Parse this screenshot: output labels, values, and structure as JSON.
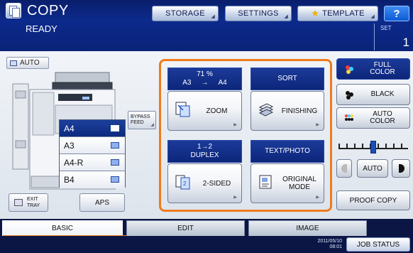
{
  "header": {
    "title": "COPY",
    "status": "READY",
    "storage_label": "STORAGE",
    "settings_label": "SETTINGS",
    "template_label": "TEMPLATE",
    "help_label": "?",
    "set_label": "SET",
    "set_value": "1"
  },
  "left": {
    "auto_label": "AUTO",
    "paper_sizes": [
      "A4",
      "A3",
      "A4-R",
      "B4"
    ],
    "selected_paper": "A4",
    "bypass_label_1": "BYPASS",
    "bypass_label_2": "FEED",
    "exit_tray_1": "EXIT",
    "exit_tray_2": "TRAY",
    "aps_label": "APS"
  },
  "functions": {
    "zoom_percent": "71 %",
    "zoom_from": "A3",
    "zoom_arrow": "→",
    "zoom_to": "A4",
    "zoom_label": "ZOOM",
    "sort_label": "SORT",
    "finishing_label": "FINISHING",
    "duplex_mode": "1→2",
    "duplex_label": "DUPLEX",
    "sided_label": "2-SIDED",
    "original_type": "TEXT/PHOTO",
    "original_mode_1": "ORIGINAL",
    "original_mode_2": "MODE"
  },
  "color": {
    "full_color_1": "FULL",
    "full_color_2": "COLOR",
    "black_label": "BLACK",
    "auto_color_1": "AUTO",
    "auto_color_2": "COLOR",
    "density_auto": "AUTO",
    "density_level": 0.5,
    "proof_copy": "PROOF COPY"
  },
  "tabs": [
    "BASIC",
    "EDIT",
    "IMAGE"
  ],
  "footer": {
    "date": "2011/05/10",
    "time": "08:01",
    "job_status": "JOB STATUS"
  },
  "colors": {
    "header_blue": "#0c2a8c",
    "accent_orange": "#f07a1c"
  }
}
